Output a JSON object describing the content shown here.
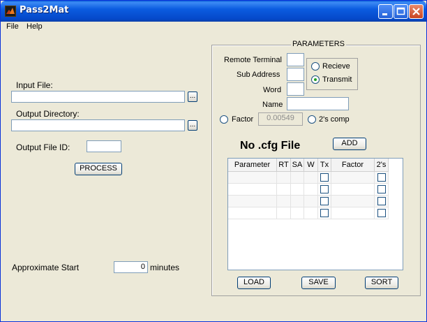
{
  "window": {
    "title": "Pass2Mat",
    "icon": "matlab-icon",
    "controls": [
      "minimize-icon",
      "maximize-icon",
      "close-icon"
    ]
  },
  "menu": {
    "file": "File",
    "help": "Help"
  },
  "left": {
    "input_file_label": "Input File:",
    "input_file_value": "",
    "output_dir_label": "Output Directory:",
    "output_dir_value": "",
    "browse_label": "...",
    "output_id_label": "Output File ID:",
    "output_id_value": "",
    "process_label": "PROCESS",
    "approx_label": "Approximate Start",
    "approx_value": "0",
    "minutes_label": "minutes"
  },
  "params": {
    "legend": "PARAMETERS",
    "remote_terminal_label": "Remote Terminal",
    "sub_address_label": "Sub Address",
    "word_label": "Word",
    "name_label": "Name",
    "remote_terminal_value": "",
    "sub_address_value": "",
    "word_value": "",
    "name_value": "",
    "receive_label": "Recieve",
    "transmit_label": "Transmit",
    "selected_direction": "Transmit",
    "factor_label": "Factor",
    "factor_value": "0.00549",
    "twos_comp_label": "2's comp",
    "cfg_status": "No .cfg File",
    "add_label": "ADD"
  },
  "table": {
    "columns": [
      "Parameter",
      "RT",
      "SA",
      "W",
      "Tx",
      "Factor",
      "2's"
    ],
    "rows": [
      {
        "parameter": "",
        "rt": "",
        "sa": "",
        "w": "",
        "tx": false,
        "factor": "",
        "twos": false
      },
      {
        "parameter": "",
        "rt": "",
        "sa": "",
        "w": "",
        "tx": false,
        "factor": "",
        "twos": false
      },
      {
        "parameter": "",
        "rt": "",
        "sa": "",
        "w": "",
        "tx": false,
        "factor": "",
        "twos": false
      },
      {
        "parameter": "",
        "rt": "",
        "sa": "",
        "w": "",
        "tx": false,
        "factor": "",
        "twos": false
      }
    ]
  },
  "buttons": {
    "load": "LOAD",
    "save": "SAVE",
    "sort": "SORT"
  },
  "colors": {
    "titlebar": "#0b5ce0",
    "window_bg": "#ece9d8",
    "radio_dot": "#21a121"
  }
}
